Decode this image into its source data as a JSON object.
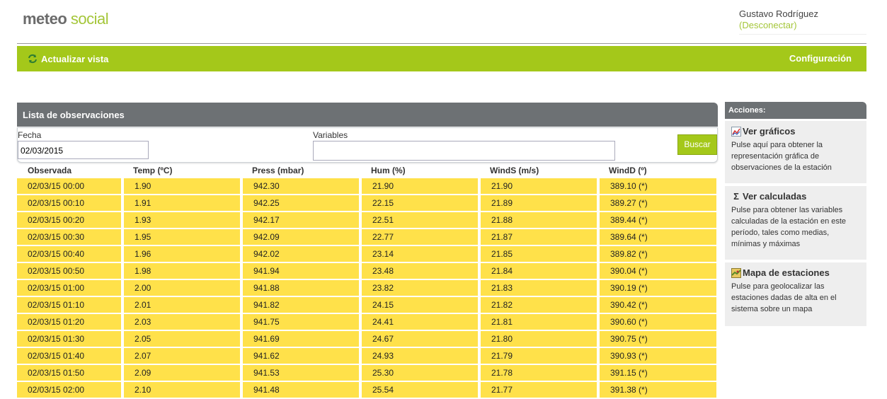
{
  "header": {
    "logo_part1": "meteo",
    "logo_part2": "social",
    "user_name": "Gustavo Rodríguez",
    "logout_label": "(Desconectar)"
  },
  "toolbar": {
    "refresh_label": "Actualizar vista",
    "config_label": "Configuración"
  },
  "main": {
    "title": "Lista de observaciones",
    "filter": {
      "date_label": "Fecha",
      "date_value": "02/03/2015",
      "variables_label": "Variables",
      "variables_value": "",
      "search_button": "Buscar"
    },
    "table": {
      "headers": [
        "Observada",
        "Temp (ºC)",
        "Press (mbar)",
        "Hum (%)",
        "WindS (m/s)",
        "WindD (º)"
      ],
      "rows": [
        [
          "02/03/15 00:00",
          "1.90",
          "942.30",
          "21.90",
          "21.90",
          "389.10 (*)"
        ],
        [
          "02/03/15 00:10",
          "1.91",
          "942.25",
          "22.15",
          "21.89",
          "389.27 (*)"
        ],
        [
          "02/03/15 00:20",
          "1.93",
          "942.17",
          "22.51",
          "21.88",
          "389.44 (*)"
        ],
        [
          "02/03/15 00:30",
          "1.95",
          "942.09",
          "22.77",
          "21.87",
          "389.64 (*)"
        ],
        [
          "02/03/15 00:40",
          "1.96",
          "942.02",
          "23.14",
          "21.85",
          "389.82 (*)"
        ],
        [
          "02/03/15 00:50",
          "1.98",
          "941.94",
          "23.48",
          "21.84",
          "390.04 (*)"
        ],
        [
          "02/03/15 01:00",
          "2.00",
          "941.88",
          "23.82",
          "21.83",
          "390.19 (*)"
        ],
        [
          "02/03/15 01:10",
          "2.01",
          "941.82",
          "24.15",
          "21.82",
          "390.42 (*)"
        ],
        [
          "02/03/15 01:20",
          "2.03",
          "941.75",
          "24.41",
          "21.81",
          "390.60 (*)"
        ],
        [
          "02/03/15 01:30",
          "2.05",
          "941.69",
          "24.67",
          "21.80",
          "390.75 (*)"
        ],
        [
          "02/03/15 01:40",
          "2.07",
          "941.62",
          "24.93",
          "21.79",
          "390.93 (*)"
        ],
        [
          "02/03/15 01:50",
          "2.09",
          "941.53",
          "25.30",
          "21.78",
          "391.15 (*)"
        ],
        [
          "02/03/15 02:00",
          "2.10",
          "941.48",
          "25.54",
          "21.77",
          "391.38 (*)"
        ]
      ]
    }
  },
  "sidebar": {
    "title": "Acciones:",
    "actions": [
      {
        "icon": "chart-icon",
        "title": "Ver gráficos",
        "desc": "Pulse aquí para obtener la representación gráfica de observaciones de la estación"
      },
      {
        "icon": "sigma-icon",
        "title": "Ver calculadas",
        "desc": "Pulse para obtener las variables calculadas de la estación en este período, tales como medias, mínimas y máximas"
      },
      {
        "icon": "map-icon",
        "title": "Mapa de estaciones",
        "desc": "Pulse para geolocalizar las estaciones dadas de alta en el sistema sobre un mapa"
      }
    ]
  },
  "colors": {
    "accent_green": "#a4c81a",
    "row_yellow": "#ffe14a",
    "panel_gray": "#6d7174"
  }
}
